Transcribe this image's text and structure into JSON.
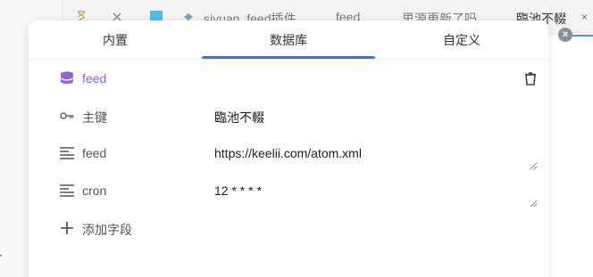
{
  "background": {
    "tabs": [
      {
        "label": "siyuan_feed插件"
      },
      {
        "label": "feed"
      },
      {
        "label": "思源更新了吗"
      },
      {
        "label": "臨池不輟"
      }
    ],
    "close_glyph": "×",
    "float_close_glyph": "×"
  },
  "dialog": {
    "tabs": [
      {
        "label": "内置"
      },
      {
        "label": "数据库"
      },
      {
        "label": "自定义"
      }
    ],
    "active_tab": "数据库",
    "database": {
      "name": "feed",
      "icon": "database-icon",
      "color": "#8b63d9"
    },
    "fields": {
      "primary_key": {
        "label": "主键",
        "icon": "key-icon",
        "value": "臨池不輟"
      },
      "feed": {
        "label": "feed",
        "icon": "text-lines-icon",
        "value": "https://keelii.com/atom.xml"
      },
      "cron": {
        "label": "cron",
        "icon": "text-lines-icon",
        "value": "12 * * * *"
      }
    },
    "add_field": {
      "label": "添加字段",
      "icon": "plus-icon"
    },
    "trash_icon": "trash-icon"
  },
  "colors": {
    "accent": "#3b73d6",
    "database": "#8b63d9"
  }
}
